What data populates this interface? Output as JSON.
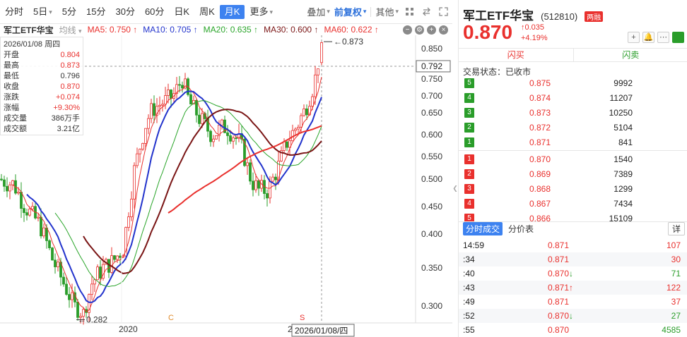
{
  "toolbar": {
    "tabs": [
      "分时",
      "5日",
      "5分",
      "15分",
      "30分",
      "60分",
      "日K",
      "周K",
      "月K",
      "更多"
    ],
    "overlay_label": "叠加",
    "adjust_label": "前复权",
    "other_label": "其他"
  },
  "ma": {
    "stock_name": "军工ETF华宝",
    "mode_label": "均线",
    "items": [
      {
        "label": "MA5: 0.750 ↑",
        "color": "#e9302d"
      },
      {
        "label": "MA10: 0.705 ↑",
        "color": "#2233cc"
      },
      {
        "label": "MA20: 0.635 ↑",
        "color": "#2aa52a"
      },
      {
        "label": "MA30: 0.600 ↑",
        "color": "#7a1515"
      },
      {
        "label": "MA60: 0.622 ↑",
        "color": "#e9302d"
      }
    ]
  },
  "info": {
    "date": "2026/01/08 周四",
    "rows": [
      {
        "k": "开盘",
        "v": "0.804",
        "red": true
      },
      {
        "k": "最高",
        "v": "0.873",
        "red": true
      },
      {
        "k": "最低",
        "v": "0.796",
        "red": false
      },
      {
        "k": "收盘",
        "v": "0.870",
        "red": true
      },
      {
        "k": "涨跌",
        "v": "+0.074",
        "red": true
      },
      {
        "k": "涨幅",
        "v": "+9.30%",
        "red": true
      },
      {
        "k": "成交量",
        "v": "386万手",
        "red": false
      },
      {
        "k": "成交额",
        "v": "3.21亿",
        "red": false
      }
    ]
  },
  "chart_data": {
    "type": "candlestick",
    "y_ticks": [
      "0.850",
      "0.750",
      "0.700",
      "0.650",
      "0.600",
      "0.550",
      "0.500",
      "0.450",
      "0.400",
      "0.350",
      "0.300"
    ],
    "current_price_label": "0.792",
    "high_label": "0.873",
    "low_label": "0.282",
    "x_labels": [
      "2020",
      "2"
    ],
    "markers": [
      "C",
      "S"
    ],
    "cursor_date": "2026/01/08/四",
    "colors": {
      "up": "#e9302d",
      "down": "#2a9d2a",
      "ma5": "#e9302d",
      "ma10": "#2233cc",
      "ma20": "#2aa52a",
      "ma30": "#7a1515",
      "ma60": "#e9302d"
    }
  },
  "quote": {
    "name": "军工ETF华宝",
    "code": "(512810)",
    "badge": "两融",
    "price": "0.870",
    "change": "↑0.035",
    "change_pct": "+4.19%",
    "flash_buy": "闪买",
    "flash_sell": "闪卖",
    "trade_status": "交易状态：已收市"
  },
  "order_book": {
    "asks": [
      {
        "lvl": "5",
        "price": "0.875",
        "vol": "9992"
      },
      {
        "lvl": "4",
        "price": "0.874",
        "vol": "11207"
      },
      {
        "lvl": "3",
        "price": "0.873",
        "vol": "10250"
      },
      {
        "lvl": "2",
        "price": "0.872",
        "vol": "5104"
      },
      {
        "lvl": "1",
        "price": "0.871",
        "vol": "841"
      }
    ],
    "bids": [
      {
        "lvl": "1",
        "price": "0.870",
        "vol": "1540"
      },
      {
        "lvl": "2",
        "price": "0.869",
        "vol": "7389"
      },
      {
        "lvl": "3",
        "price": "0.868",
        "vol": "1299"
      },
      {
        "lvl": "4",
        "price": "0.867",
        "vol": "7434"
      },
      {
        "lvl": "5",
        "price": "0.866",
        "vol": "15109"
      }
    ]
  },
  "ticks_panel": {
    "tab1": "分时成交",
    "tab2": "分价表",
    "detail": "详",
    "rows": [
      {
        "t": "14:59",
        "p": "0.871",
        "arrow": "",
        "v": "107",
        "vc": "r"
      },
      {
        "t": ":34",
        "p": "0.871",
        "arrow": "",
        "v": "30",
        "vc": "r"
      },
      {
        "t": ":40",
        "p": "0.870",
        "arrow": "↓",
        "v": "71",
        "vc": "g"
      },
      {
        "t": ":43",
        "p": "0.871",
        "arrow": "↑",
        "v": "122",
        "vc": "r"
      },
      {
        "t": ":49",
        "p": "0.871",
        "arrow": "",
        "v": "37",
        "vc": "r"
      },
      {
        "t": ":52",
        "p": "0.870",
        "arrow": "↓",
        "v": "27",
        "vc": "g"
      },
      {
        "t": ":55",
        "p": "0.870",
        "arrow": "",
        "v": "4585",
        "vc": "g"
      }
    ]
  }
}
